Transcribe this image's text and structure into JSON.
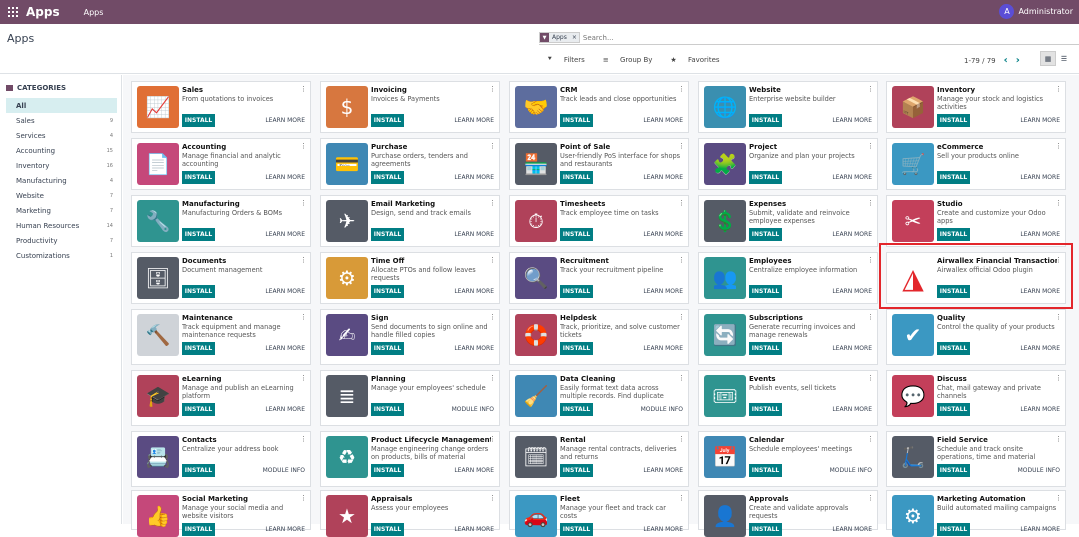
{
  "topbar": {
    "brand": "Apps",
    "menu": "Apps",
    "user_initial": "A",
    "user_name": "Administrator"
  },
  "control_panel": {
    "title": "Apps",
    "facet_label": "Apps",
    "facet_remove": "×",
    "search_placeholder": "Search...",
    "filters": "Filters",
    "group_by": "Group By",
    "favorites": "Favorites",
    "pager": "1-79 / 79",
    "prev": "‹",
    "next": "›"
  },
  "sidebar": {
    "heading": "CATEGORIES",
    "items": [
      {
        "label": "All",
        "count": ""
      },
      {
        "label": "Sales",
        "count": "9"
      },
      {
        "label": "Services",
        "count": "4"
      },
      {
        "label": "Accounting",
        "count": "15"
      },
      {
        "label": "Inventory",
        "count": "16"
      },
      {
        "label": "Manufacturing",
        "count": "4"
      },
      {
        "label": "Website",
        "count": "7"
      },
      {
        "label": "Marketing",
        "count": "7"
      },
      {
        "label": "Human Resources",
        "count": "14"
      },
      {
        "label": "Productivity",
        "count": "7"
      },
      {
        "label": "Customizations",
        "count": "1"
      }
    ]
  },
  "colors": {
    "brand": "#714b67",
    "accent": "#017e84",
    "highlight": "#e3262b"
  },
  "apps": [
    {
      "title": "Sales",
      "desc": "From quotations to invoices",
      "button": "INSTALL",
      "link": "LEARN MORE",
      "color": "#e06f35",
      "icon": "📈"
    },
    {
      "title": "Invoicing",
      "desc": "Invoices & Payments",
      "button": "INSTALL",
      "link": "LEARN MORE",
      "color": "#d7773f",
      "icon": "$"
    },
    {
      "title": "CRM",
      "desc": "Track leads and close opportunities",
      "button": "INSTALL",
      "link": "LEARN MORE",
      "color": "#5d6d9e",
      "icon": "🤝"
    },
    {
      "title": "Website",
      "desc": "Enterprise website builder",
      "button": "INSTALL",
      "link": "LEARN MORE",
      "color": "#3a8fb0",
      "icon": "🌐"
    },
    {
      "title": "Inventory",
      "desc": "Manage your stock and logistics activities",
      "button": "INSTALL",
      "link": "LEARN MORE",
      "color": "#b0425a",
      "icon": "📦"
    },
    {
      "title": "Accounting",
      "desc": "Manage financial and analytic accounting",
      "button": "INSTALL",
      "link": "LEARN MORE",
      "color": "#c5487a",
      "icon": "📄"
    },
    {
      "title": "Purchase",
      "desc": "Purchase orders, tenders and agreements",
      "button": "INSTALL",
      "link": "LEARN MORE",
      "color": "#3f88b4",
      "icon": "💳"
    },
    {
      "title": "Point of Sale",
      "desc": "User-friendly PoS interface for shops and restaurants",
      "button": "INSTALL",
      "link": "LEARN MORE",
      "color": "#555b66",
      "icon": "🏪"
    },
    {
      "title": "Project",
      "desc": "Organize and plan your projects",
      "button": "INSTALL",
      "link": "LEARN MORE",
      "color": "#5a4b82",
      "icon": "🧩"
    },
    {
      "title": "eCommerce",
      "desc": "Sell your products online",
      "button": "INSTALL",
      "link": "LEARN MORE",
      "color": "#3b98c2",
      "icon": "🛒"
    },
    {
      "title": "Manufacturing",
      "desc": "Manufacturing Orders & BOMs",
      "button": "INSTALL",
      "link": "LEARN MORE",
      "color": "#2f9490",
      "icon": "🔧"
    },
    {
      "title": "Email Marketing",
      "desc": "Design, send and track emails",
      "button": "INSTALL",
      "link": "LEARN MORE",
      "color": "#555b66",
      "icon": "✈"
    },
    {
      "title": "Timesheets",
      "desc": "Track employee time on tasks",
      "button": "INSTALL",
      "link": "LEARN MORE",
      "color": "#b0425a",
      "icon": "⏱"
    },
    {
      "title": "Expenses",
      "desc": "Submit, validate and reinvoice employee expenses",
      "button": "INSTALL",
      "link": "LEARN MORE",
      "color": "#555b66",
      "icon": "💲"
    },
    {
      "title": "Studio",
      "desc": "Create and customize your Odoo apps",
      "button": "INSTALL",
      "link": "LEARN MORE",
      "color": "#c33f5a",
      "icon": "✂"
    },
    {
      "title": "Documents",
      "desc": "Document management",
      "button": "INSTALL",
      "link": "LEARN MORE",
      "color": "#555b66",
      "icon": "🗄"
    },
    {
      "title": "Time Off",
      "desc": "Allocate PTOs and follow leaves requests",
      "button": "INSTALL",
      "link": "LEARN MORE",
      "color": "#d89a38",
      "icon": "⚙"
    },
    {
      "title": "Recruitment",
      "desc": "Track your recruitment pipeline",
      "button": "INSTALL",
      "link": "LEARN MORE",
      "color": "#5a4b82",
      "icon": "🔍"
    },
    {
      "title": "Employees",
      "desc": "Centralize employee information",
      "button": "INSTALL",
      "link": "LEARN MORE",
      "color": "#2f9490",
      "icon": "👥"
    },
    {
      "title": "Airwallex Financial Transaction",
      "desc": "Airwallex official Odoo plugin",
      "button": "INSTALL",
      "link": "LEARN MORE",
      "color": "#ffffff",
      "icon": "◮"
    },
    {
      "title": "Maintenance",
      "desc": "Track equipment and manage maintenance requests",
      "button": "INSTALL",
      "link": "LEARN MORE",
      "color": "#cfd3d8",
      "icon": "🔨"
    },
    {
      "title": "Sign",
      "desc": "Send documents to sign online and handle filled copies",
      "button": "INSTALL",
      "link": "LEARN MORE",
      "color": "#5a4b82",
      "icon": "✍"
    },
    {
      "title": "Helpdesk",
      "desc": "Track, prioritize, and solve customer tickets",
      "button": "INSTALL",
      "link": "LEARN MORE",
      "color": "#b0425a",
      "icon": "🛟"
    },
    {
      "title": "Subscriptions",
      "desc": "Generate recurring invoices and manage renewals",
      "button": "INSTALL",
      "link": "LEARN MORE",
      "color": "#2f9490",
      "icon": "🔄"
    },
    {
      "title": "Quality",
      "desc": "Control the quality of your products",
      "button": "INSTALL",
      "link": "LEARN MORE",
      "color": "#3b98c2",
      "icon": "✔"
    },
    {
      "title": "eLearning",
      "desc": "Manage and publish an eLearning platform",
      "button": "INSTALL",
      "link": "LEARN MORE",
      "color": "#b0425a",
      "icon": "🎓"
    },
    {
      "title": "Planning",
      "desc": "Manage your employees' schedule",
      "button": "INSTALL",
      "link": "MODULE INFO",
      "color": "#555b66",
      "icon": "≣"
    },
    {
      "title": "Data Cleaning",
      "desc": "Easily format text data across multiple records. Find duplicate records and easily merge them.",
      "button": "INSTALL",
      "link": "MODULE INFO",
      "color": "#3f88b4",
      "icon": "🧹"
    },
    {
      "title": "Events",
      "desc": "Publish events, sell tickets",
      "button": "INSTALL",
      "link": "LEARN MORE",
      "color": "#2f9490",
      "icon": "🎟"
    },
    {
      "title": "Discuss",
      "desc": "Chat, mail gateway and private channels",
      "button": "INSTALL",
      "link": "LEARN MORE",
      "color": "#c33f5a",
      "icon": "💬"
    },
    {
      "title": "Contacts",
      "desc": "Centralize your address book",
      "button": "INSTALL",
      "link": "MODULE INFO",
      "color": "#5a4b82",
      "icon": "📇"
    },
    {
      "title": "Product Lifecycle Management (...",
      "desc": "Manage engineering change orders on products, bills of material",
      "button": "INSTALL",
      "link": "LEARN MORE",
      "color": "#2f9490",
      "icon": "♻"
    },
    {
      "title": "Rental",
      "desc": "Manage rental contracts, deliveries and returns",
      "button": "INSTALL",
      "link": "LEARN MORE",
      "color": "#555b66",
      "icon": "🗓"
    },
    {
      "title": "Calendar",
      "desc": "Schedule employees' meetings",
      "button": "INSTALL",
      "link": "MODULE INFO",
      "color": "#3f88b4",
      "icon": "📅"
    },
    {
      "title": "Field Service",
      "desc": "Schedule and track onsite operations, time and material",
      "button": "INSTALL",
      "link": "MODULE INFO",
      "color": "#555b66",
      "icon": "🛴"
    },
    {
      "title": "Social Marketing",
      "desc": "Manage your social media and website visitors",
      "button": "INSTALL",
      "link": "LEARN MORE",
      "color": "#c5487a",
      "icon": "👍"
    },
    {
      "title": "Appraisals",
      "desc": "Assess your employees",
      "button": "INSTALL",
      "link": "LEARN MORE",
      "color": "#b0425a",
      "icon": "★"
    },
    {
      "title": "Fleet",
      "desc": "Manage your fleet and track car costs",
      "button": "INSTALL",
      "link": "LEARN MORE",
      "color": "#3b98c2",
      "icon": "🚗"
    },
    {
      "title": "Approvals",
      "desc": "Create and validate approvals requests",
      "button": "INSTALL",
      "link": "LEARN MORE",
      "color": "#555b66",
      "icon": "👤"
    },
    {
      "title": "Marketing Automation",
      "desc": "Build automated mailing campaigns",
      "button": "INSTALL",
      "link": "LEARN MORE",
      "color": "#3b98c2",
      "icon": "⚙"
    }
  ]
}
